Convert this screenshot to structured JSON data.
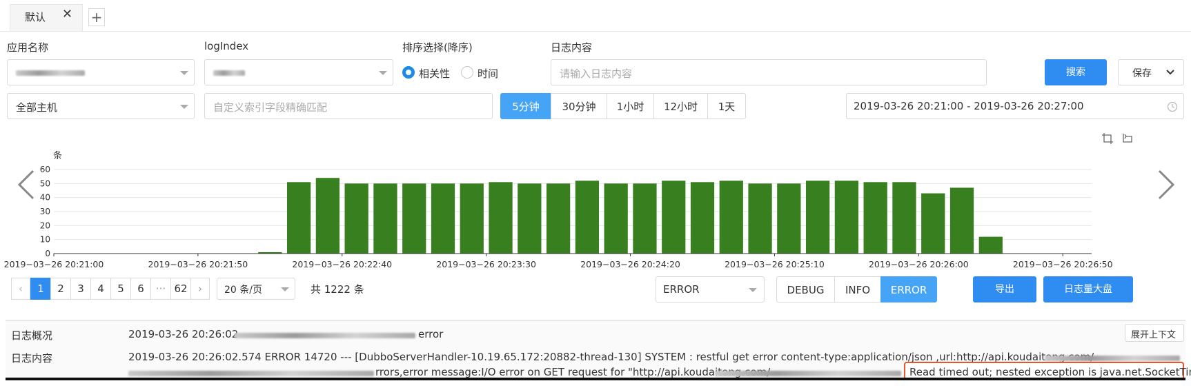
{
  "tabs": {
    "active_label": "默认",
    "close_glyph": "✕",
    "add_glyph": "+"
  },
  "filters": {
    "app_label": "应用名称",
    "logindex_label": "logIndex",
    "sort_label": "排序选择(降序)",
    "sort_options": [
      "相关性",
      "时间"
    ],
    "sort_selected": "相关性",
    "content_label": "日志内容",
    "content_placeholder": "请输入日志内容",
    "search_button": "搜索",
    "save_button": "保存",
    "host_value": "全部主机",
    "custom_index_placeholder": "自定义索引字段精确匹配",
    "time_ranges": [
      "5分钟",
      "30分钟",
      "1小时",
      "12小时",
      "1天"
    ],
    "time_range_selected": "5分钟",
    "datetime_range": "2019-03-26 20:21:00 - 2019-03-26 20:27:00"
  },
  "chart_data": {
    "type": "bar",
    "ylabel": "条",
    "ylim": [
      0,
      60
    ],
    "yticks": [
      0,
      10,
      20,
      30,
      40,
      50,
      60
    ],
    "x_tick_labels": [
      "2019−03−26 20:21:00",
      "2019−03−26 20:21:50",
      "2019−03−26 20:22:40",
      "2019−03−26 20:23:30",
      "2019−03−26 20:24:20",
      "2019−03−26 20:25:10",
      "2019−03−26 20:26:00",
      "2019−03−26 20:26:50"
    ],
    "x_start_seconds": 0,
    "bin_seconds": 10,
    "values": [
      0,
      0,
      0,
      0,
      0,
      0,
      0,
      1,
      51,
      54,
      50,
      50,
      50,
      50,
      50,
      51,
      50,
      50,
      52,
      50,
      50,
      52,
      51,
      52,
      50,
      50,
      52,
      52,
      51,
      51,
      43,
      47,
      12,
      0,
      0,
      0
    ],
    "color": "#38801f",
    "grid": true
  },
  "pagination": {
    "prev_glyph": "‹",
    "pages": [
      "1",
      "2",
      "3",
      "4",
      "5",
      "6",
      "···",
      "62"
    ],
    "current": "1",
    "next_glyph": "›",
    "page_size": "20 条/页",
    "total": "共 1222 条"
  },
  "level_select": "ERROR",
  "levels": [
    "DEBUG",
    "INFO",
    "ERROR"
  ],
  "level_selected": "ERROR",
  "export_button": "导出",
  "dashboard_button": "日志量大盘",
  "expand_context_button": "展开上下文",
  "log": {
    "summary_label": "日志概况",
    "summary_prefix": "2019-03-26 20:26:02",
    "summary_suffix": "error",
    "content_label": "日志内容",
    "content_line1": "2019-03-26 20:26:02.574 ERROR 14720 --- [DubboServerHandler-10.19.65.172:20882-thread-130] SYSTEM : restful get error content-type:application/json ,url:http://api.koudaitong.com/",
    "content_line2_mid": "rrors,error message:I/O error on GET request for \"http://api.koudaitong.com/",
    "highlight": "Read timed out; nested exception is java.net.SocketTime"
  }
}
